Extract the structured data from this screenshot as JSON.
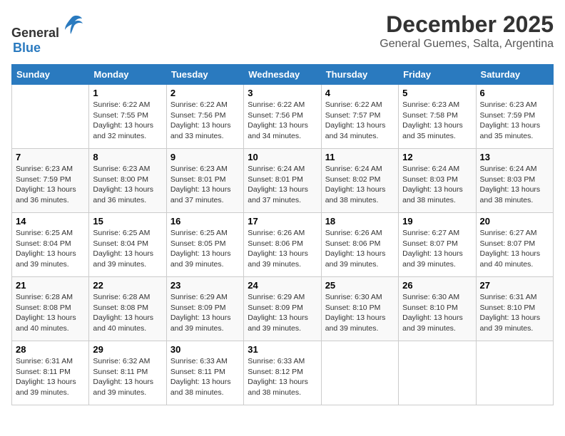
{
  "header": {
    "logo_general": "General",
    "logo_blue": "Blue",
    "month": "December 2025",
    "location": "General Guemes, Salta, Argentina"
  },
  "weekdays": [
    "Sunday",
    "Monday",
    "Tuesday",
    "Wednesday",
    "Thursday",
    "Friday",
    "Saturday"
  ],
  "weeks": [
    [
      {
        "day": "",
        "info": ""
      },
      {
        "day": "1",
        "info": "Sunrise: 6:22 AM\nSunset: 7:55 PM\nDaylight: 13 hours\nand 32 minutes."
      },
      {
        "day": "2",
        "info": "Sunrise: 6:22 AM\nSunset: 7:56 PM\nDaylight: 13 hours\nand 33 minutes."
      },
      {
        "day": "3",
        "info": "Sunrise: 6:22 AM\nSunset: 7:56 PM\nDaylight: 13 hours\nand 34 minutes."
      },
      {
        "day": "4",
        "info": "Sunrise: 6:22 AM\nSunset: 7:57 PM\nDaylight: 13 hours\nand 34 minutes."
      },
      {
        "day": "5",
        "info": "Sunrise: 6:23 AM\nSunset: 7:58 PM\nDaylight: 13 hours\nand 35 minutes."
      },
      {
        "day": "6",
        "info": "Sunrise: 6:23 AM\nSunset: 7:59 PM\nDaylight: 13 hours\nand 35 minutes."
      }
    ],
    [
      {
        "day": "7",
        "info": "Sunrise: 6:23 AM\nSunset: 7:59 PM\nDaylight: 13 hours\nand 36 minutes."
      },
      {
        "day": "8",
        "info": "Sunrise: 6:23 AM\nSunset: 8:00 PM\nDaylight: 13 hours\nand 36 minutes."
      },
      {
        "day": "9",
        "info": "Sunrise: 6:23 AM\nSunset: 8:01 PM\nDaylight: 13 hours\nand 37 minutes."
      },
      {
        "day": "10",
        "info": "Sunrise: 6:24 AM\nSunset: 8:01 PM\nDaylight: 13 hours\nand 37 minutes."
      },
      {
        "day": "11",
        "info": "Sunrise: 6:24 AM\nSunset: 8:02 PM\nDaylight: 13 hours\nand 38 minutes."
      },
      {
        "day": "12",
        "info": "Sunrise: 6:24 AM\nSunset: 8:03 PM\nDaylight: 13 hours\nand 38 minutes."
      },
      {
        "day": "13",
        "info": "Sunrise: 6:24 AM\nSunset: 8:03 PM\nDaylight: 13 hours\nand 38 minutes."
      }
    ],
    [
      {
        "day": "14",
        "info": "Sunrise: 6:25 AM\nSunset: 8:04 PM\nDaylight: 13 hours\nand 39 minutes."
      },
      {
        "day": "15",
        "info": "Sunrise: 6:25 AM\nSunset: 8:04 PM\nDaylight: 13 hours\nand 39 minutes."
      },
      {
        "day": "16",
        "info": "Sunrise: 6:25 AM\nSunset: 8:05 PM\nDaylight: 13 hours\nand 39 minutes."
      },
      {
        "day": "17",
        "info": "Sunrise: 6:26 AM\nSunset: 8:06 PM\nDaylight: 13 hours\nand 39 minutes."
      },
      {
        "day": "18",
        "info": "Sunrise: 6:26 AM\nSunset: 8:06 PM\nDaylight: 13 hours\nand 39 minutes."
      },
      {
        "day": "19",
        "info": "Sunrise: 6:27 AM\nSunset: 8:07 PM\nDaylight: 13 hours\nand 39 minutes."
      },
      {
        "day": "20",
        "info": "Sunrise: 6:27 AM\nSunset: 8:07 PM\nDaylight: 13 hours\nand 40 minutes."
      }
    ],
    [
      {
        "day": "21",
        "info": "Sunrise: 6:28 AM\nSunset: 8:08 PM\nDaylight: 13 hours\nand 40 minutes."
      },
      {
        "day": "22",
        "info": "Sunrise: 6:28 AM\nSunset: 8:08 PM\nDaylight: 13 hours\nand 40 minutes."
      },
      {
        "day": "23",
        "info": "Sunrise: 6:29 AM\nSunset: 8:09 PM\nDaylight: 13 hours\nand 39 minutes."
      },
      {
        "day": "24",
        "info": "Sunrise: 6:29 AM\nSunset: 8:09 PM\nDaylight: 13 hours\nand 39 minutes."
      },
      {
        "day": "25",
        "info": "Sunrise: 6:30 AM\nSunset: 8:10 PM\nDaylight: 13 hours\nand 39 minutes."
      },
      {
        "day": "26",
        "info": "Sunrise: 6:30 AM\nSunset: 8:10 PM\nDaylight: 13 hours\nand 39 minutes."
      },
      {
        "day": "27",
        "info": "Sunrise: 6:31 AM\nSunset: 8:10 PM\nDaylight: 13 hours\nand 39 minutes."
      }
    ],
    [
      {
        "day": "28",
        "info": "Sunrise: 6:31 AM\nSunset: 8:11 PM\nDaylight: 13 hours\nand 39 minutes."
      },
      {
        "day": "29",
        "info": "Sunrise: 6:32 AM\nSunset: 8:11 PM\nDaylight: 13 hours\nand 39 minutes."
      },
      {
        "day": "30",
        "info": "Sunrise: 6:33 AM\nSunset: 8:11 PM\nDaylight: 13 hours\nand 38 minutes."
      },
      {
        "day": "31",
        "info": "Sunrise: 6:33 AM\nSunset: 8:12 PM\nDaylight: 13 hours\nand 38 minutes."
      },
      {
        "day": "",
        "info": ""
      },
      {
        "day": "",
        "info": ""
      },
      {
        "day": "",
        "info": ""
      }
    ]
  ]
}
